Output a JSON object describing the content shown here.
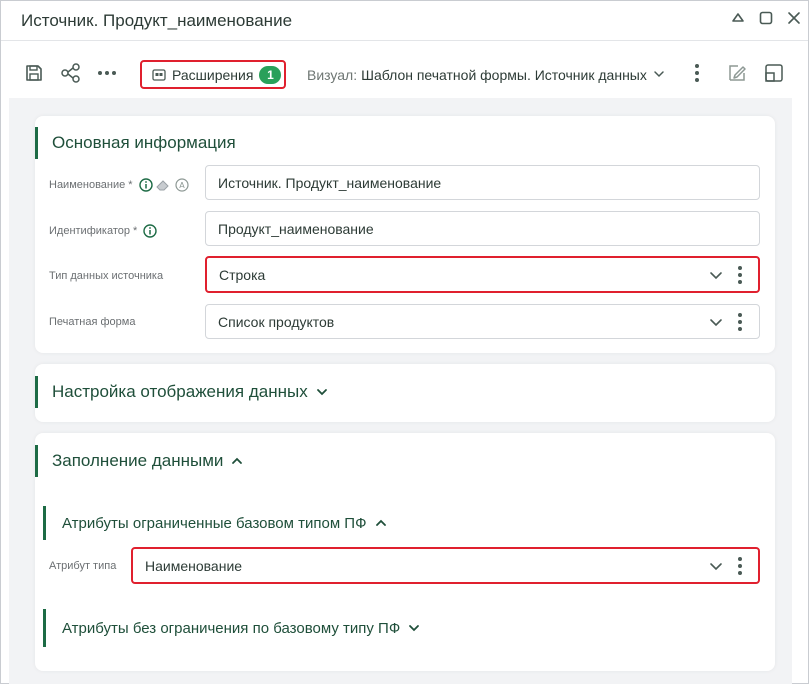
{
  "window": {
    "title": "Источник. Продукт_наименование"
  },
  "toolbar": {
    "extensions_label": "Расширения",
    "extensions_count": "1",
    "visual_label": "Визуал:",
    "visual_value": "Шаблон печатной формы. Источник данных"
  },
  "main_info": {
    "heading": "Основная информация",
    "name_label": "Наименование *",
    "name_value": "Источник. Продукт_наименование",
    "id_label": "Идентификатор *",
    "id_value": "Продукт_наименование",
    "type_label": "Тип данных источника",
    "type_value": "Строка",
    "print_label": "Печатная форма",
    "print_value": "Список продуктов"
  },
  "display_settings": {
    "heading": "Настройка отображения данных"
  },
  "fill": {
    "heading": "Заполнение данными",
    "limited_heading": "Атрибуты ограниченные базовом типом ПФ",
    "attr_type_label": "Атрибут типа",
    "attr_type_value": "Наименование",
    "unlimited_heading": "Атрибуты без ограничения по базовому типу ПФ"
  },
  "colors": {
    "accent_green": "#1d6b45",
    "badge_green": "#29a05a",
    "highlight_red": "#e0202e"
  },
  "icons": [
    "save-icon",
    "hierarchy-icon",
    "more-horizontal-icon",
    "extensions-icon",
    "chevron-down-icon",
    "more-vertical-icon",
    "edit-icon",
    "layout-icon",
    "info-icon",
    "eraser-icon",
    "auto-icon",
    "minimize-icon",
    "maximize-icon",
    "close-icon"
  ]
}
